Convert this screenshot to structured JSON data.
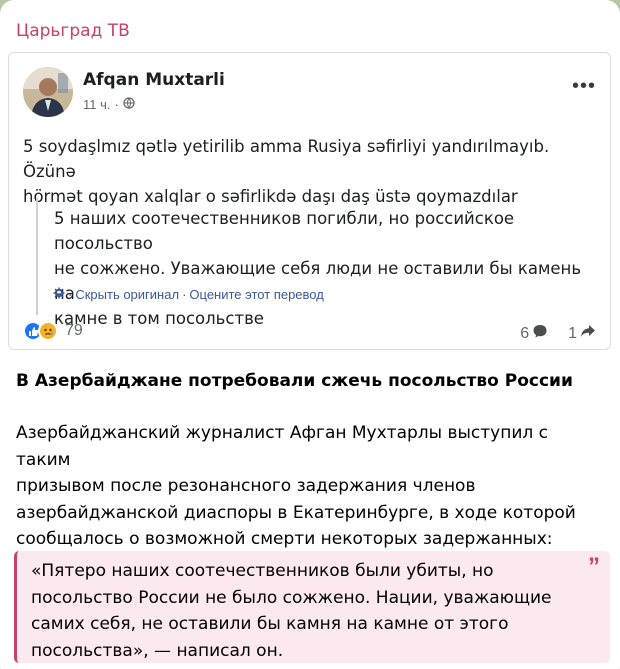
{
  "channel": {
    "name": "Царьград ТВ"
  },
  "fb_post": {
    "author": "Afqan Muxtarli",
    "time": "11 ч.",
    "separator": "·",
    "text_lines": [
      "5 soydaşlmız qətlə yetirilib amma Rusiya səfirliyi yandırılmayıb. Özünə",
      "hörmət qoyan xalqlar o səfirlikdə daşı daş üstə qoymazdılar"
    ],
    "translation_lines": [
      "5 наших соотечественников погибли, но российское посольство",
      "не сожжено. Уважающие себя люди не оставили бы камень на",
      "камне в том посольстве"
    ],
    "links": {
      "prefix": "·",
      "hide_original": "Скрыть оригинал",
      "sep": "·",
      "rate_translation": "Оцените этот перевод"
    },
    "reactions_count": "79",
    "comments_count": "6",
    "shares_count": "1"
  },
  "article": {
    "headline": "В Азербайджане потребовали сжечь посольство России",
    "body_lines": [
      "Азербайджанский журналист Афган Мухтарлы выступил с таким",
      "призывом после резонансного задержания членов",
      "азербайджанской диаспоры в Екатеринбурге, в ходе которой",
      "сообщалось о возможной смерти некоторых задержанных:"
    ],
    "quote_lines": [
      "«Пятеро наших соотечественников были убиты, но",
      "посольство России не было сожжено. Нации, уважающие",
      "самих себя, не оставили бы камня на камне от этого",
      "посольства», — написал он."
    ],
    "quote_mark": "”"
  },
  "colors": {
    "channel_accent": "#c5416b",
    "link_blue": "#385898",
    "quote_bg": "#fbe9ef"
  },
  "icons": [
    "globe-icon",
    "more-icon",
    "gear-icon",
    "like-icon",
    "sad-icon",
    "comment-icon",
    "share-icon"
  ]
}
